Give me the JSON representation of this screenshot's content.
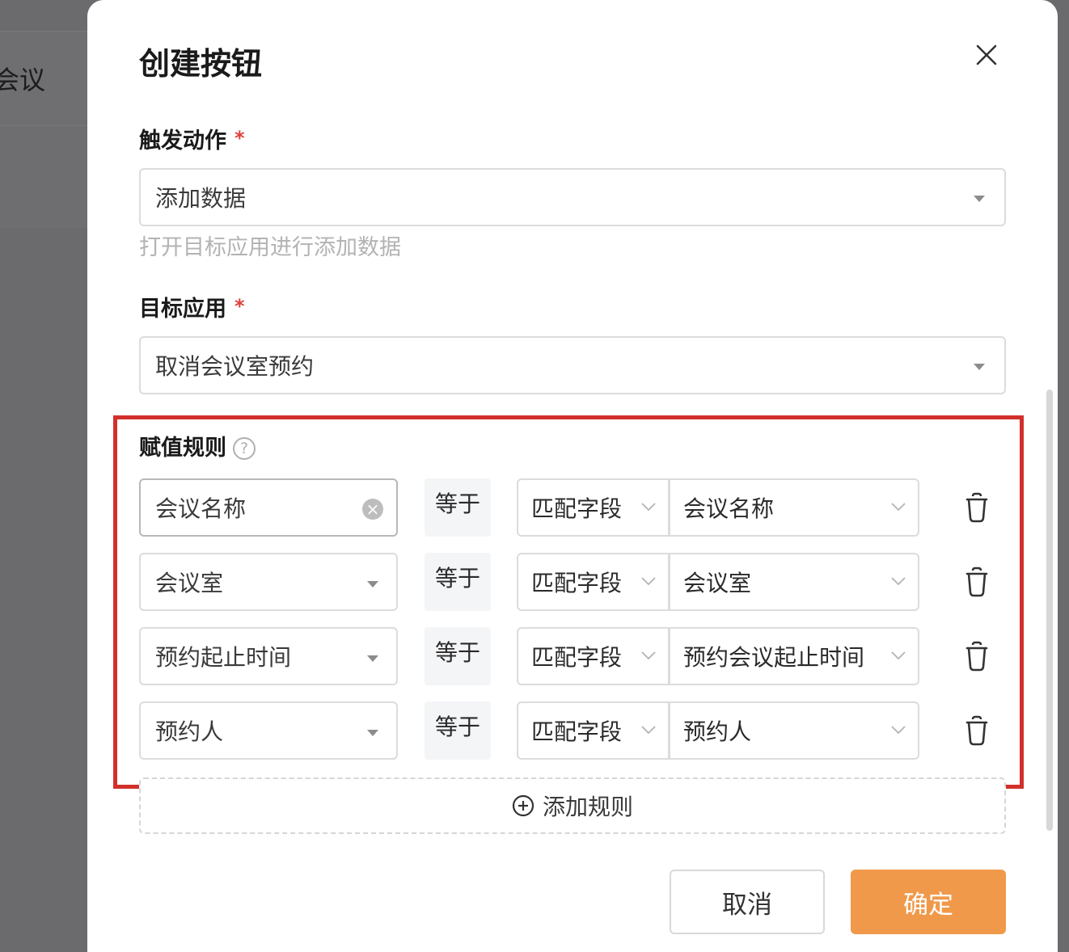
{
  "background": {
    "header_text": "会议"
  },
  "modal": {
    "title": "创建按钮",
    "trigger": {
      "label": "触发动作",
      "required_mark": "*",
      "value": "添加数据",
      "help": "打开目标应用进行添加数据"
    },
    "target": {
      "label": "目标应用",
      "required_mark": "*",
      "value": "取消会议室预约"
    },
    "rules": {
      "label": "赋值规则",
      "help_glyph": "?",
      "items": [
        {
          "field": "会议名称",
          "operator": "等于",
          "type": "匹配字段",
          "value": "会议名称"
        },
        {
          "field": "会议室",
          "operator": "等于",
          "type": "匹配字段",
          "value": "会议室"
        },
        {
          "field": "预约起止时间",
          "operator": "等于",
          "type": "匹配字段",
          "value": "预约会议起止时间"
        },
        {
          "field": "预约人",
          "operator": "等于",
          "type": "匹配字段",
          "value": "预约人"
        }
      ],
      "add_label": "添加规则"
    },
    "footer": {
      "cancel_label": "取消",
      "ok_label": "确定"
    }
  },
  "colors": {
    "accent": "#f0994a",
    "required": "#e0403a",
    "highlight": "#d1302b"
  }
}
